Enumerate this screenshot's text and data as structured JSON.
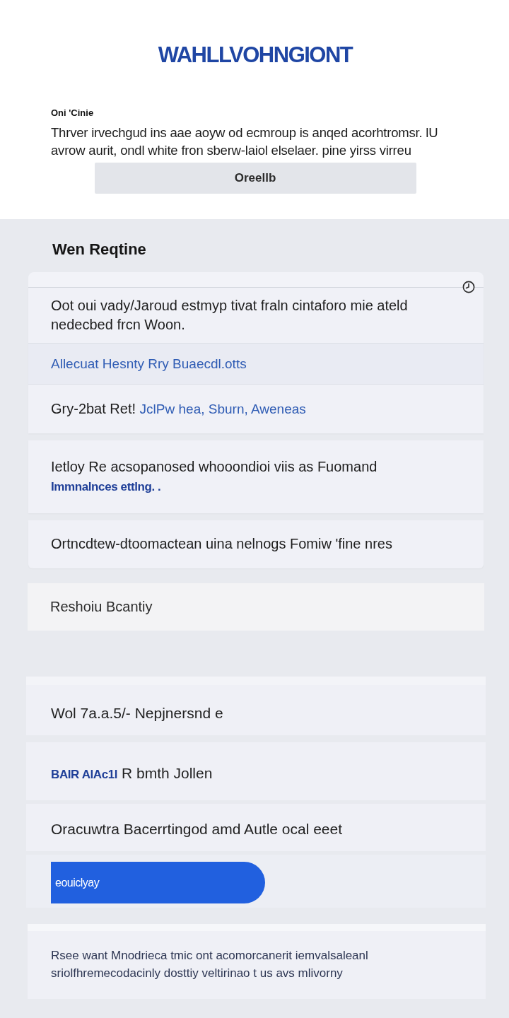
{
  "header": {
    "title": "WAHLLVOHNGIONT",
    "label": "Oni 'Cinie",
    "description": "Thrver irvechgud ins aae aoyw od ecmroup is anqed acorhtromsr. lU avrow aurit, ondl white fron sberw-laiol elselaer. pine yirss virreu",
    "button": "Oreellb"
  },
  "section": {
    "heading": "Wen Reqtine"
  },
  "list_card": {
    "items": [
      {
        "parts": [
          {
            "kind": "text",
            "text": "Oot oui vady/Jaroud estmyp tivat fraln cintaforo mie ateld nedecbed frcn Woon."
          }
        ]
      },
      {
        "parts": [
          {
            "kind": "link",
            "text": "Allecuat Hesnty Rry Buaecdl.otts"
          }
        ]
      },
      {
        "parts": [
          {
            "kind": "text",
            "text": "Gry-2bat Ret!"
          },
          {
            "kind": "link",
            "text": "JclPw hea, Sburn, Aweneas"
          }
        ]
      },
      {
        "parts": [
          {
            "kind": "text",
            "text": "Ietloy Re acsopanosed whooondioi viis as Fuomand"
          },
          {
            "kind": "bold-link",
            "text": "Immnalnces ettlng. ."
          }
        ]
      },
      {
        "parts": [
          {
            "kind": "text",
            "text": "Ortncdtew-dtoomactean uina nelnogs Fomiw 'fine nres"
          }
        ]
      }
    ]
  },
  "single_card": {
    "text": "Reshoiu Bcantiy"
  },
  "rows_card": {
    "items": [
      {
        "parts": [
          {
            "kind": "text",
            "text": "Wol 7a.a.5/- Nepjnersnd e"
          }
        ]
      },
      {
        "parts": [
          {
            "kind": "bold-link",
            "text": "BAIR AlAc1l"
          },
          {
            "kind": "text",
            "text": "R bmth Jollen"
          }
        ]
      },
      {
        "parts": [
          {
            "kind": "text",
            "text": "Oracuwtra Bacerrtingod amd Autle ocal eeet"
          }
        ]
      }
    ]
  },
  "action_button": "eouiclyay",
  "note": "Rsee want Mnodrieca tmic ont acomorcanerit iemvalsaleanl sriolfhremecodacinly dosttiy veltirinao t us avs mlivorny"
}
